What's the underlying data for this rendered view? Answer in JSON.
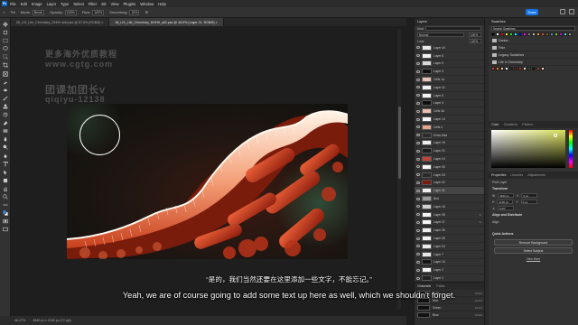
{
  "app": {
    "logo": "Ps",
    "menu": [
      "File",
      "Edit",
      "Image",
      "Layer",
      "Type",
      "Select",
      "Filter",
      "3D",
      "View",
      "Plugins",
      "Window",
      "Help"
    ],
    "share_label": "Share"
  },
  "options_bar": {
    "mode_label": "Mode:",
    "mode_value": "Brush",
    "opacity_label": "Opacity:",
    "opacity_value": "100%",
    "flow_label": "Flow:",
    "flow_value": "100%",
    "smoothing_label": "Smoothing:",
    "smoothing_value": "10%"
  },
  "tabs": [
    {
      "label": "08_LIS_Life_Chemistry_DHHH.sdd.psd @ 67.8% (RGB/8) ×",
      "active": false
    },
    {
      "label": "08_LIS_Life_Chemistry_DHHH_all2.psd @ 46.5% (Layer 31, RGB/8) ×",
      "active": true
    }
  ],
  "watermark": {
    "line1": "更多海外优质教程",
    "line2": "www.cgtg.com",
    "line3": "团课加团长v",
    "line4": "qiqiyu-12138"
  },
  "subtitles": {
    "chinese": "“是的，我们当然还要在这里添加一些文字，不能忘记。”",
    "english": "Yeah, we are of course going to add some text up here as well, which we shouldn't forget."
  },
  "statusbar": {
    "zoom": "46.47%",
    "doc": "3840 px x 2160 px (72 ppi)"
  },
  "layers_panel": {
    "title": "Layers",
    "kind_label": "Kind",
    "blend_mode": "Normal",
    "opacity": "100%",
    "lock_label": "Lock:",
    "fill": "100%",
    "layers": [
      {
        "name": "Layer 44",
        "fx": ""
      },
      {
        "name": "Layer 8",
        "fx": ""
      },
      {
        "name": "Layer 9",
        "fx": ""
      },
      {
        "name": "Layer 3",
        "fx": ""
      },
      {
        "name": "Cells 1a",
        "fx": ""
      },
      {
        "name": "Layer 41",
        "fx": ""
      },
      {
        "name": "Layer 5",
        "fx": ""
      },
      {
        "name": "Layer 4",
        "fx": ""
      },
      {
        "name": "Cells 3a",
        "fx": ""
      },
      {
        "name": "Layer 13",
        "fx": ""
      },
      {
        "name": "Cells 4",
        "fx": ""
      },
      {
        "name": "Extra Zala",
        "fx": ""
      },
      {
        "name": "Layer 19",
        "fx": ""
      },
      {
        "name": "Layer 21",
        "fx": ""
      },
      {
        "name": "Layer 24",
        "fx": ""
      },
      {
        "name": "Layer 30",
        "fx": ""
      },
      {
        "name": "Layer 33",
        "fx": ""
      },
      {
        "name": "Layer 32",
        "fx": ""
      },
      {
        "name": "Layer 31",
        "fx": ""
      },
      {
        "name": "Bed",
        "fx": ""
      },
      {
        "name": "Layer 16",
        "fx": ""
      },
      {
        "name": "Layer 38",
        "fx": "fx"
      },
      {
        "name": "Layer 37",
        "fx": "fx"
      },
      {
        "name": "Layer 36",
        "fx": ""
      },
      {
        "name": "Layer 35",
        "fx": ""
      },
      {
        "name": "Layer 34",
        "fx": ""
      },
      {
        "name": "Layer 7",
        "fx": ""
      },
      {
        "name": "Layer 10",
        "fx": ""
      },
      {
        "name": "Layer 2",
        "fx": ""
      },
      {
        "name": "Layer 1",
        "fx": ""
      }
    ]
  },
  "channels_panel": {
    "title": "Channels",
    "tab2": "Paths",
    "channels": [
      {
        "name": "RGB",
        "shortcut": "Ctrl+2"
      },
      {
        "name": "Red",
        "shortcut": "Ctrl+3"
      },
      {
        "name": "Green",
        "shortcut": "Ctrl+4"
      },
      {
        "name": "Blue",
        "shortcut": "Ctrl+5"
      }
    ]
  },
  "swatches_panel": {
    "title": "Swatches",
    "search_placeholder": "Search Swatches",
    "swatches": [
      "#000000",
      "#ffffff",
      "#ff0000",
      "#ffff00",
      "#00ff00",
      "#00ffff",
      "#0000ff",
      "#ff00ff",
      "#808080",
      "#c0c0c0",
      "#f5a623",
      "#e0533a",
      "#8b572a",
      "#4a90e2",
      "#7ed321",
      "#bd10e0",
      "#50e3c2",
      "#9b9b9b"
    ],
    "folders": [
      "Darker",
      "Pale",
      "Legacy Swatches",
      "Life in Chemistry"
    ],
    "life_swatches": [
      "#d93a1f",
      "#f07c3a",
      "#f7c6a0",
      "#ffffff",
      "#1f2b26",
      "#6e1d12",
      "#b82a1a",
      "#f2e4d8",
      "#2d4a3c",
      "#0a0a0a",
      "#a4452b",
      "#ffe0c2"
    ]
  },
  "color_panel": {
    "tabs": [
      "Color",
      "Gradients",
      "Pattern"
    ],
    "foreground": "#e9ec61",
    "background": "#ffffff"
  },
  "properties_panel": {
    "tabs": [
      "Properties",
      "Libraries",
      "Adjustments"
    ],
    "layer_kind": "Pixel Layer",
    "transform_label": "Transform",
    "w_label": "W",
    "w_value": "3840 px",
    "h_label": "H",
    "h_value": "2160 px",
    "x_label": "X",
    "x_value": "0 px",
    "y_label": "Y",
    "y_value": "0 px",
    "angle_value": "0.00°",
    "align_label": "Align and Distribute",
    "align_sub": "Align:",
    "quick_actions_label": "Quick Actions",
    "qa_buttons": [
      "Remove Background",
      "Select Subject"
    ],
    "more_link": "View More"
  }
}
